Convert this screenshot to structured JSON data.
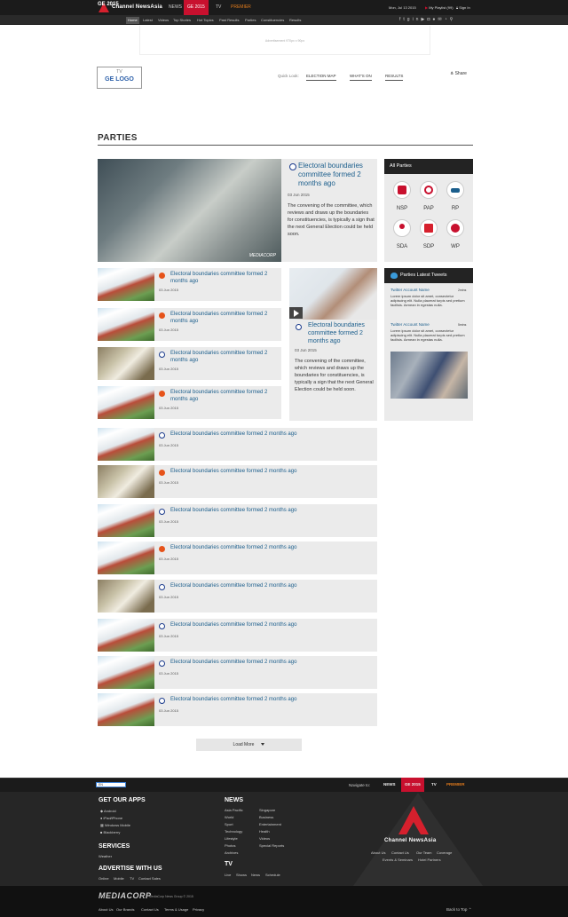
{
  "header": {
    "brand": "Channel NewsAsia",
    "nav": [
      "NEWS",
      "GE 2015",
      "TV",
      "PREMIER"
    ],
    "date": "Mon, Jul 13 2015",
    "playlist": "My Playlist (99)",
    "signin": "Sign In"
  },
  "subnav": {
    "title": "GE 2015",
    "items": [
      "Home",
      "Latest",
      "Videos",
      "Top Stories",
      "Hot Topics",
      "Past Results",
      "Parties",
      "Constituencies",
      "Results"
    ]
  },
  "ad": "Advertisement 970px x 90px",
  "ge_logo": {
    "small": "TV",
    "main": "GE LOGO"
  },
  "quick_look": {
    "label": "Quick Look:",
    "links": [
      "ELECTION MAP",
      "WHAT'S ON",
      "RESULTS"
    ]
  },
  "share": "Share",
  "page_title": "PARTIES",
  "featured": {
    "title": "Electoral boundaries committee formed 2 months ago",
    "date": "03 Jun 2015",
    "desc": "The convening of the committee, which reviews and draws up the boundaries for constituencies, is typically a sign that the next General Election could be held soon.",
    "watermark": "MEDIACORP"
  },
  "rows": [
    {
      "title": "Electoral boundaries committee formed 2 months ago",
      "date": "03 Jun 2015"
    },
    {
      "title": "Electoral boundaries committee formed 2 months ago",
      "date": "03 Jun 2015"
    },
    {
      "title": "Electoral boundaries committee formed 2 months ago",
      "date": "03 Jun 2015"
    },
    {
      "title": "Electoral boundaries committee formed 2 months ago",
      "date": "03 Jun 2015"
    },
    {
      "title": "Electoral boundaries committee formed 2 months ago",
      "date": "03 Jun 2015"
    },
    {
      "title": "Electoral boundaries committee formed 2 months ago",
      "date": "03 Jun 2015"
    },
    {
      "title": "Electoral boundaries committee formed 2 months ago",
      "date": "03 Jun 2015"
    },
    {
      "title": "Electoral boundaries committee formed 2 months ago",
      "date": "03 Jun 2015"
    },
    {
      "title": "Electoral boundaries committee formed 2 months ago",
      "date": "03 Jun 2015"
    },
    {
      "title": "Electoral boundaries committee formed 2 months ago",
      "date": "03 Jun 2015"
    },
    {
      "title": "Electoral boundaries committee formed 2 months ago",
      "date": "03 Jun 2015"
    },
    {
      "title": "Electoral boundaries committee formed 2 months ago",
      "date": "03 Jun 2015"
    }
  ],
  "middle_card": {
    "title": "Electoral boundaries committee formed 2 months ago",
    "date": "03 Jun 2015",
    "desc": "The convening of the committee, which reviews and draws up the boundaries for constituencies, is typically a sign that the next General Election could be held soon."
  },
  "all_parties": {
    "heading": "All Parties",
    "parties": [
      "NSP",
      "PAP",
      "RP",
      "SDA",
      "SDP",
      "WP"
    ]
  },
  "tweets": {
    "heading": "Parties Latest Tweets",
    "items": [
      {
        "account": "Twitter Account Name",
        "time": "2mins",
        "text": "Lorem ipsum dolor sit amet, consectetur adipiscing elit. Nulla placerat turpis sed pretium facilisis. Aenean in egestas nulla."
      },
      {
        "account": "Twitter Account Name",
        "time": "5mins",
        "text": "Lorem ipsum dolor sit amet, consectetur adipiscing elit. Nulla placerat turpis sed pretium facilisis. Aenean in egestas nulla."
      }
    ]
  },
  "load_more": "Load More",
  "footer": {
    "lang": "EN",
    "navigate_to": "Navigate to:",
    "nav": [
      "NEWS",
      "GE 2015",
      "TV",
      "PREMIER"
    ],
    "apps_heading": "GET OUR APPS",
    "apps": [
      "Android",
      "iPad/iPhone",
      "Windows Mobile",
      "Blackberry"
    ],
    "services_heading": "SERVICES",
    "services": [
      "Weather"
    ],
    "advertise_heading": "ADVERTISE WITH US",
    "advertise": [
      "Online",
      "Mobile",
      "TV",
      "Contact Sales"
    ],
    "news_heading": "NEWS",
    "news_col1": [
      "Asia Pacific",
      "World",
      "Sport",
      "Technology",
      "Lifestyle",
      "Photos",
      "Archives"
    ],
    "news_col2": [
      "Singapore",
      "Business",
      "Entertainment",
      "Health",
      "Videos",
      "Special Reports"
    ],
    "tv_heading": "TV",
    "tv": [
      "Live",
      "Shows",
      "News",
      "Schedule"
    ],
    "brand": "Channel NewsAsia",
    "brand_links1": [
      "About Us",
      "Contact Us",
      "Our Team",
      "Coverage"
    ],
    "brand_links2": [
      "Events & Seminars",
      "Hotel Partners"
    ],
    "mediacorp": "MEDIACORP",
    "copyright": "MediaCorp News Group © 2015",
    "bottom_links": [
      "About Us",
      "Our Brands",
      "Contact Us",
      "Terms & Usage",
      "Privacy"
    ],
    "back_to_top": "Back to Top"
  },
  "colors": {
    "brand_red": "#c8102e",
    "link_blue": "#1b5e8c",
    "premier_orange": "#e07a1c"
  }
}
